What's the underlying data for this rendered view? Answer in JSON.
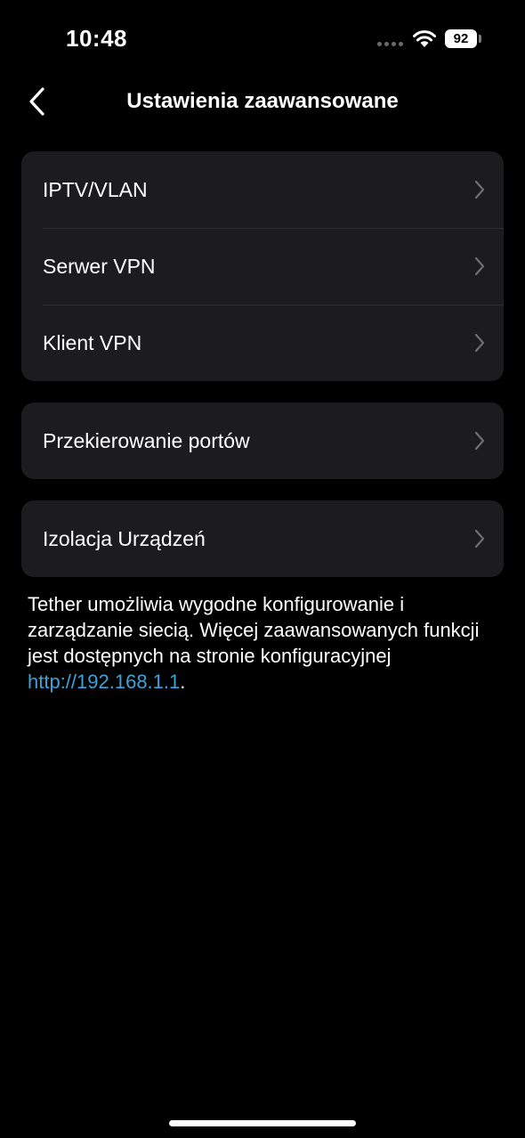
{
  "status_bar": {
    "time": "10:48",
    "battery_level": "92"
  },
  "header": {
    "title": "Ustawienia zaawansowane",
    "back_icon": "chevron-left-icon"
  },
  "groups": [
    {
      "items": [
        {
          "label": "IPTV/VLAN"
        },
        {
          "label": "Serwer VPN"
        },
        {
          "label": "Klient VPN"
        }
      ]
    },
    {
      "items": [
        {
          "label": "Przekierowanie portów"
        }
      ]
    },
    {
      "items": [
        {
          "label": "Izolacja Urządzeń"
        }
      ]
    }
  ],
  "footer": {
    "text_before_link": "Tether umożliwia wygodne konfigurowanie i zarządzanie siecią. Więcej zaawansowanych funkcji jest dostępnych na stronie konfiguracyjnej ",
    "link_text": "http://192.168.1.1",
    "text_after_link": "."
  },
  "colors": {
    "background": "#000000",
    "card": "#1c1c1e",
    "link": "#3aa3d9",
    "chevron": "#6e6e73"
  }
}
